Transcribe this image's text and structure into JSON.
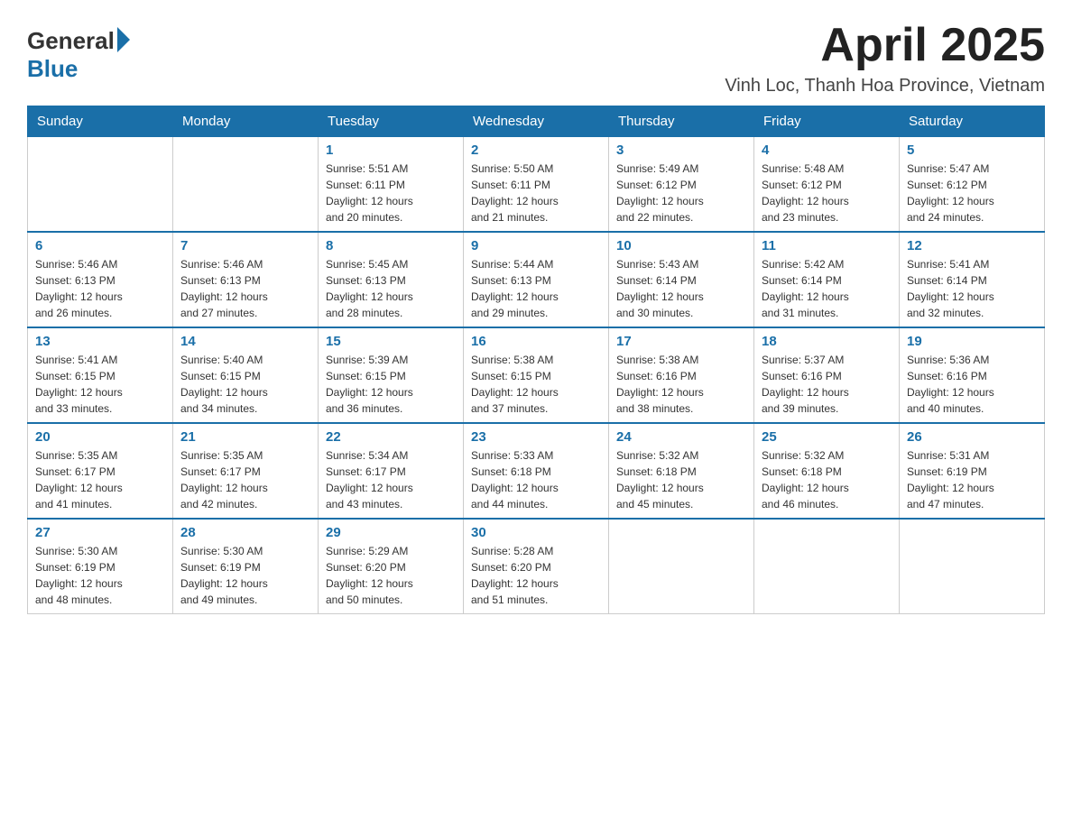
{
  "header": {
    "logo_general": "General",
    "logo_blue": "Blue",
    "month_title": "April 2025",
    "location": "Vinh Loc, Thanh Hoa Province, Vietnam"
  },
  "days_of_week": [
    "Sunday",
    "Monday",
    "Tuesday",
    "Wednesday",
    "Thursday",
    "Friday",
    "Saturday"
  ],
  "weeks": [
    [
      {
        "day": "",
        "info": ""
      },
      {
        "day": "",
        "info": ""
      },
      {
        "day": "1",
        "info": "Sunrise: 5:51 AM\nSunset: 6:11 PM\nDaylight: 12 hours\nand 20 minutes."
      },
      {
        "day": "2",
        "info": "Sunrise: 5:50 AM\nSunset: 6:11 PM\nDaylight: 12 hours\nand 21 minutes."
      },
      {
        "day": "3",
        "info": "Sunrise: 5:49 AM\nSunset: 6:12 PM\nDaylight: 12 hours\nand 22 minutes."
      },
      {
        "day": "4",
        "info": "Sunrise: 5:48 AM\nSunset: 6:12 PM\nDaylight: 12 hours\nand 23 minutes."
      },
      {
        "day": "5",
        "info": "Sunrise: 5:47 AM\nSunset: 6:12 PM\nDaylight: 12 hours\nand 24 minutes."
      }
    ],
    [
      {
        "day": "6",
        "info": "Sunrise: 5:46 AM\nSunset: 6:13 PM\nDaylight: 12 hours\nand 26 minutes."
      },
      {
        "day": "7",
        "info": "Sunrise: 5:46 AM\nSunset: 6:13 PM\nDaylight: 12 hours\nand 27 minutes."
      },
      {
        "day": "8",
        "info": "Sunrise: 5:45 AM\nSunset: 6:13 PM\nDaylight: 12 hours\nand 28 minutes."
      },
      {
        "day": "9",
        "info": "Sunrise: 5:44 AM\nSunset: 6:13 PM\nDaylight: 12 hours\nand 29 minutes."
      },
      {
        "day": "10",
        "info": "Sunrise: 5:43 AM\nSunset: 6:14 PM\nDaylight: 12 hours\nand 30 minutes."
      },
      {
        "day": "11",
        "info": "Sunrise: 5:42 AM\nSunset: 6:14 PM\nDaylight: 12 hours\nand 31 minutes."
      },
      {
        "day": "12",
        "info": "Sunrise: 5:41 AM\nSunset: 6:14 PM\nDaylight: 12 hours\nand 32 minutes."
      }
    ],
    [
      {
        "day": "13",
        "info": "Sunrise: 5:41 AM\nSunset: 6:15 PM\nDaylight: 12 hours\nand 33 minutes."
      },
      {
        "day": "14",
        "info": "Sunrise: 5:40 AM\nSunset: 6:15 PM\nDaylight: 12 hours\nand 34 minutes."
      },
      {
        "day": "15",
        "info": "Sunrise: 5:39 AM\nSunset: 6:15 PM\nDaylight: 12 hours\nand 36 minutes."
      },
      {
        "day": "16",
        "info": "Sunrise: 5:38 AM\nSunset: 6:15 PM\nDaylight: 12 hours\nand 37 minutes."
      },
      {
        "day": "17",
        "info": "Sunrise: 5:38 AM\nSunset: 6:16 PM\nDaylight: 12 hours\nand 38 minutes."
      },
      {
        "day": "18",
        "info": "Sunrise: 5:37 AM\nSunset: 6:16 PM\nDaylight: 12 hours\nand 39 minutes."
      },
      {
        "day": "19",
        "info": "Sunrise: 5:36 AM\nSunset: 6:16 PM\nDaylight: 12 hours\nand 40 minutes."
      }
    ],
    [
      {
        "day": "20",
        "info": "Sunrise: 5:35 AM\nSunset: 6:17 PM\nDaylight: 12 hours\nand 41 minutes."
      },
      {
        "day": "21",
        "info": "Sunrise: 5:35 AM\nSunset: 6:17 PM\nDaylight: 12 hours\nand 42 minutes."
      },
      {
        "day": "22",
        "info": "Sunrise: 5:34 AM\nSunset: 6:17 PM\nDaylight: 12 hours\nand 43 minutes."
      },
      {
        "day": "23",
        "info": "Sunrise: 5:33 AM\nSunset: 6:18 PM\nDaylight: 12 hours\nand 44 minutes."
      },
      {
        "day": "24",
        "info": "Sunrise: 5:32 AM\nSunset: 6:18 PM\nDaylight: 12 hours\nand 45 minutes."
      },
      {
        "day": "25",
        "info": "Sunrise: 5:32 AM\nSunset: 6:18 PM\nDaylight: 12 hours\nand 46 minutes."
      },
      {
        "day": "26",
        "info": "Sunrise: 5:31 AM\nSunset: 6:19 PM\nDaylight: 12 hours\nand 47 minutes."
      }
    ],
    [
      {
        "day": "27",
        "info": "Sunrise: 5:30 AM\nSunset: 6:19 PM\nDaylight: 12 hours\nand 48 minutes."
      },
      {
        "day": "28",
        "info": "Sunrise: 5:30 AM\nSunset: 6:19 PM\nDaylight: 12 hours\nand 49 minutes."
      },
      {
        "day": "29",
        "info": "Sunrise: 5:29 AM\nSunset: 6:20 PM\nDaylight: 12 hours\nand 50 minutes."
      },
      {
        "day": "30",
        "info": "Sunrise: 5:28 AM\nSunset: 6:20 PM\nDaylight: 12 hours\nand 51 minutes."
      },
      {
        "day": "",
        "info": ""
      },
      {
        "day": "",
        "info": ""
      },
      {
        "day": "",
        "info": ""
      }
    ]
  ]
}
